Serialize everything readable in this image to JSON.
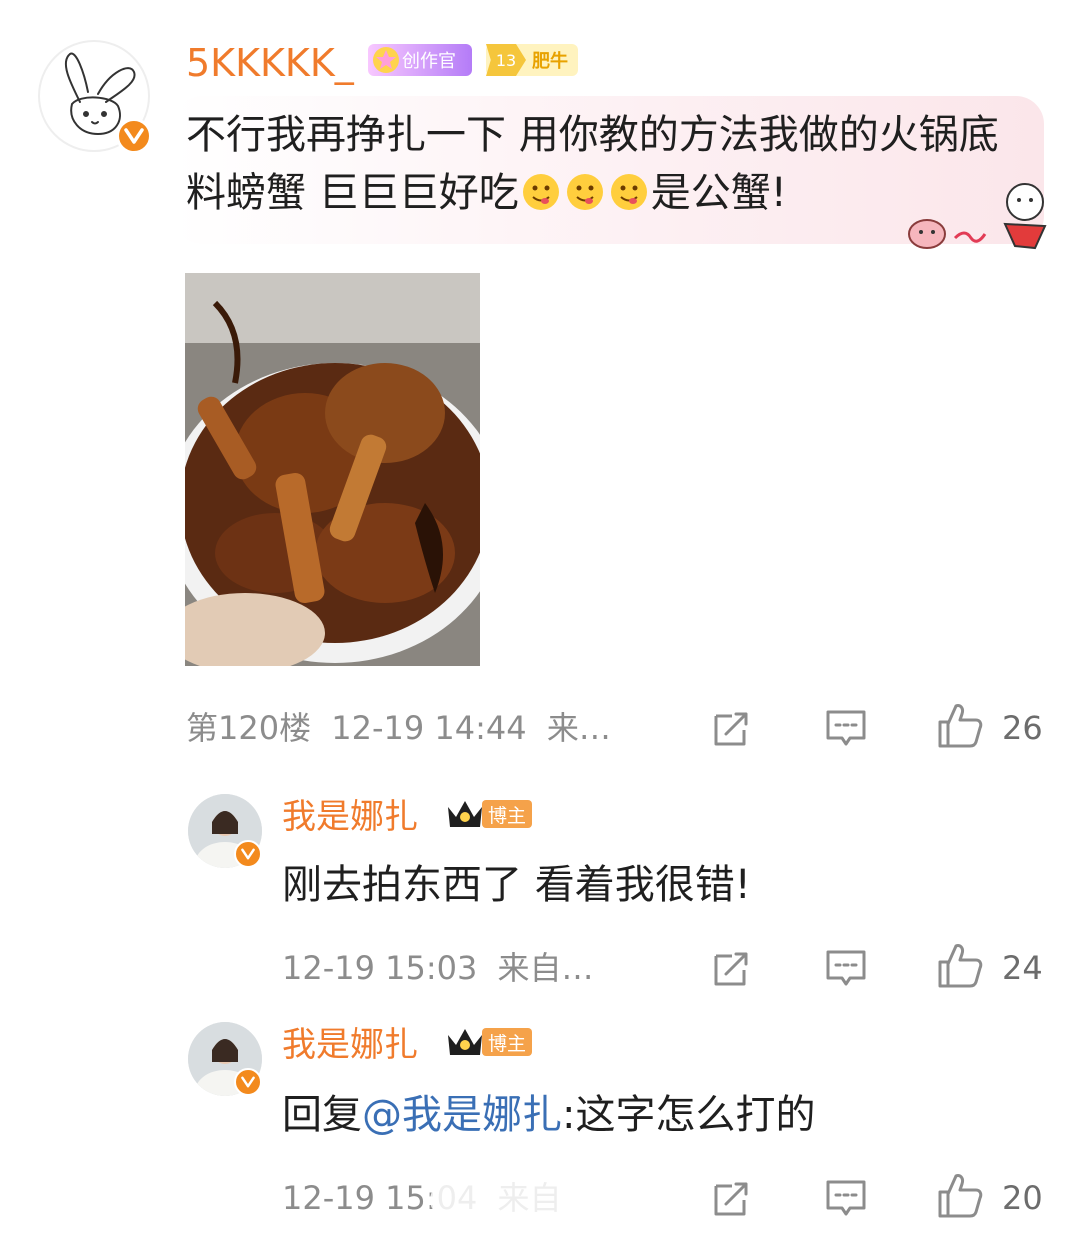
{
  "main_comment": {
    "username": "5KKKKK_",
    "creator_badge": "创作官",
    "level_number": "13",
    "level_label": "肥牛",
    "text_part1": "不行我再挣扎一下 用你教的方法我做的火锅底料螃蟹 巨巨巨好吃",
    "text_part2": "是公蟹!",
    "floor": "第120楼",
    "timestamp": "12-19 14:44",
    "source": "来…",
    "like_count": "26"
  },
  "replies": [
    {
      "username": "我是娜扎",
      "role_badge": "博主",
      "text": "刚去拍东西了 看着我很错!",
      "timestamp": "12-19 15:03",
      "source": "来自…",
      "like_count": "24"
    },
    {
      "username": "我是娜扎",
      "role_badge": "博主",
      "reply_prefix": "回复",
      "mention": "@我是娜扎",
      "text": ":这字怎么打的",
      "timestamp": "12-19 15:04",
      "source": "来自",
      "like_count": "20"
    }
  ],
  "icons": {
    "share": "share-icon",
    "comment": "comment-icon",
    "like": "thumbs-up-icon"
  },
  "colors": {
    "username": "#f07b2c",
    "mention": "#3a6fb5",
    "meta_gray": "#8c8c8c",
    "verified": "#f38a1d"
  }
}
